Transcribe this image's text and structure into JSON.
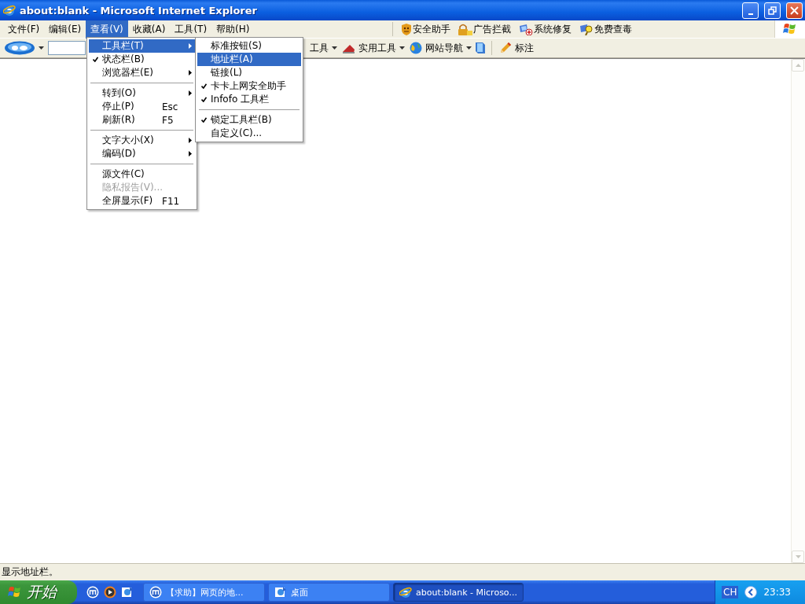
{
  "window": {
    "title": "about:blank - Microsoft Internet Explorer"
  },
  "menu_bar": {
    "items": [
      {
        "label": "文件(F)",
        "selected": false
      },
      {
        "label": "编辑(E)",
        "selected": false
      },
      {
        "label": "查看(V)",
        "selected": true
      },
      {
        "label": "收藏(A)",
        "selected": false
      },
      {
        "label": "工具(T)",
        "selected": false
      },
      {
        "label": "帮助(H)",
        "selected": false
      }
    ],
    "addons": [
      {
        "label": "安全助手"
      },
      {
        "label": "广告拦截"
      },
      {
        "label": "系统修复"
      },
      {
        "label": "免费查毒"
      }
    ]
  },
  "toolbar": {
    "buttons": [
      {
        "label": "工具",
        "dropdown": true
      },
      {
        "label": "实用工具",
        "dropdown": true
      },
      {
        "label": "网站导航",
        "dropdown": true
      }
    ],
    "mark_button": {
      "label": "标注"
    }
  },
  "view_menu": {
    "items": [
      {
        "kind": "item",
        "label": "工具栏(T)",
        "checked": false,
        "submenu": true,
        "selected": true,
        "disabled": false
      },
      {
        "kind": "item",
        "label": "状态栏(B)",
        "checked": true,
        "submenu": false,
        "selected": false,
        "disabled": false
      },
      {
        "kind": "item",
        "label": "浏览器栏(E)",
        "checked": false,
        "submenu": true,
        "selected": false,
        "disabled": false
      },
      {
        "kind": "separator"
      },
      {
        "kind": "item",
        "label": "转到(O)",
        "checked": false,
        "submenu": true,
        "selected": false,
        "disabled": false
      },
      {
        "kind": "item",
        "label": "停止(P)",
        "shortcut": "Esc",
        "checked": false,
        "submenu": false,
        "selected": false,
        "disabled": false
      },
      {
        "kind": "item",
        "label": "刷新(R)",
        "shortcut": "F5",
        "checked": false,
        "submenu": false,
        "selected": false,
        "disabled": false
      },
      {
        "kind": "separator"
      },
      {
        "kind": "item",
        "label": "文字大小(X)",
        "checked": false,
        "submenu": true,
        "selected": false,
        "disabled": false
      },
      {
        "kind": "item",
        "label": "编码(D)",
        "checked": false,
        "submenu": true,
        "selected": false,
        "disabled": false
      },
      {
        "kind": "separator"
      },
      {
        "kind": "item",
        "label": "源文件(C)",
        "checked": false,
        "submenu": false,
        "selected": false,
        "disabled": false
      },
      {
        "kind": "item",
        "label": "隐私报告(V)...",
        "checked": false,
        "submenu": false,
        "selected": false,
        "disabled": true
      },
      {
        "kind": "item",
        "label": "全屏显示(F)",
        "shortcut": "F11",
        "checked": false,
        "submenu": false,
        "selected": false,
        "disabled": false
      }
    ]
  },
  "toolbars_submenu": {
    "items": [
      {
        "kind": "item",
        "label": "标准按钮(S)",
        "checked": false,
        "submenu": false,
        "selected": false,
        "disabled": false
      },
      {
        "kind": "item",
        "label": "地址栏(A)",
        "checked": false,
        "submenu": false,
        "selected": true,
        "disabled": false
      },
      {
        "kind": "item",
        "label": "链接(L)",
        "checked": false,
        "submenu": false,
        "selected": false,
        "disabled": false
      },
      {
        "kind": "item",
        "label": "卡卡上网安全助手",
        "checked": true,
        "submenu": false,
        "selected": false,
        "disabled": false
      },
      {
        "kind": "item",
        "label": "Infofo 工具栏",
        "checked": true,
        "submenu": false,
        "selected": false,
        "disabled": false
      },
      {
        "kind": "separator"
      },
      {
        "kind": "item",
        "label": "锁定工具栏(B)",
        "checked": true,
        "submenu": false,
        "selected": false,
        "disabled": false
      },
      {
        "kind": "item",
        "label": "自定义(C)...",
        "checked": false,
        "submenu": false,
        "selected": false,
        "disabled": false
      }
    ]
  },
  "status_bar": {
    "text": "显示地址栏。"
  },
  "taskbar": {
    "start_label": "开始",
    "tasks": [
      {
        "label": "【求助】网页的地...",
        "selected": false
      },
      {
        "label": "桌面",
        "selected": false
      },
      {
        "label": "about:blank - Microso...",
        "selected": true
      }
    ],
    "language": "CH",
    "clock": "23:33"
  }
}
